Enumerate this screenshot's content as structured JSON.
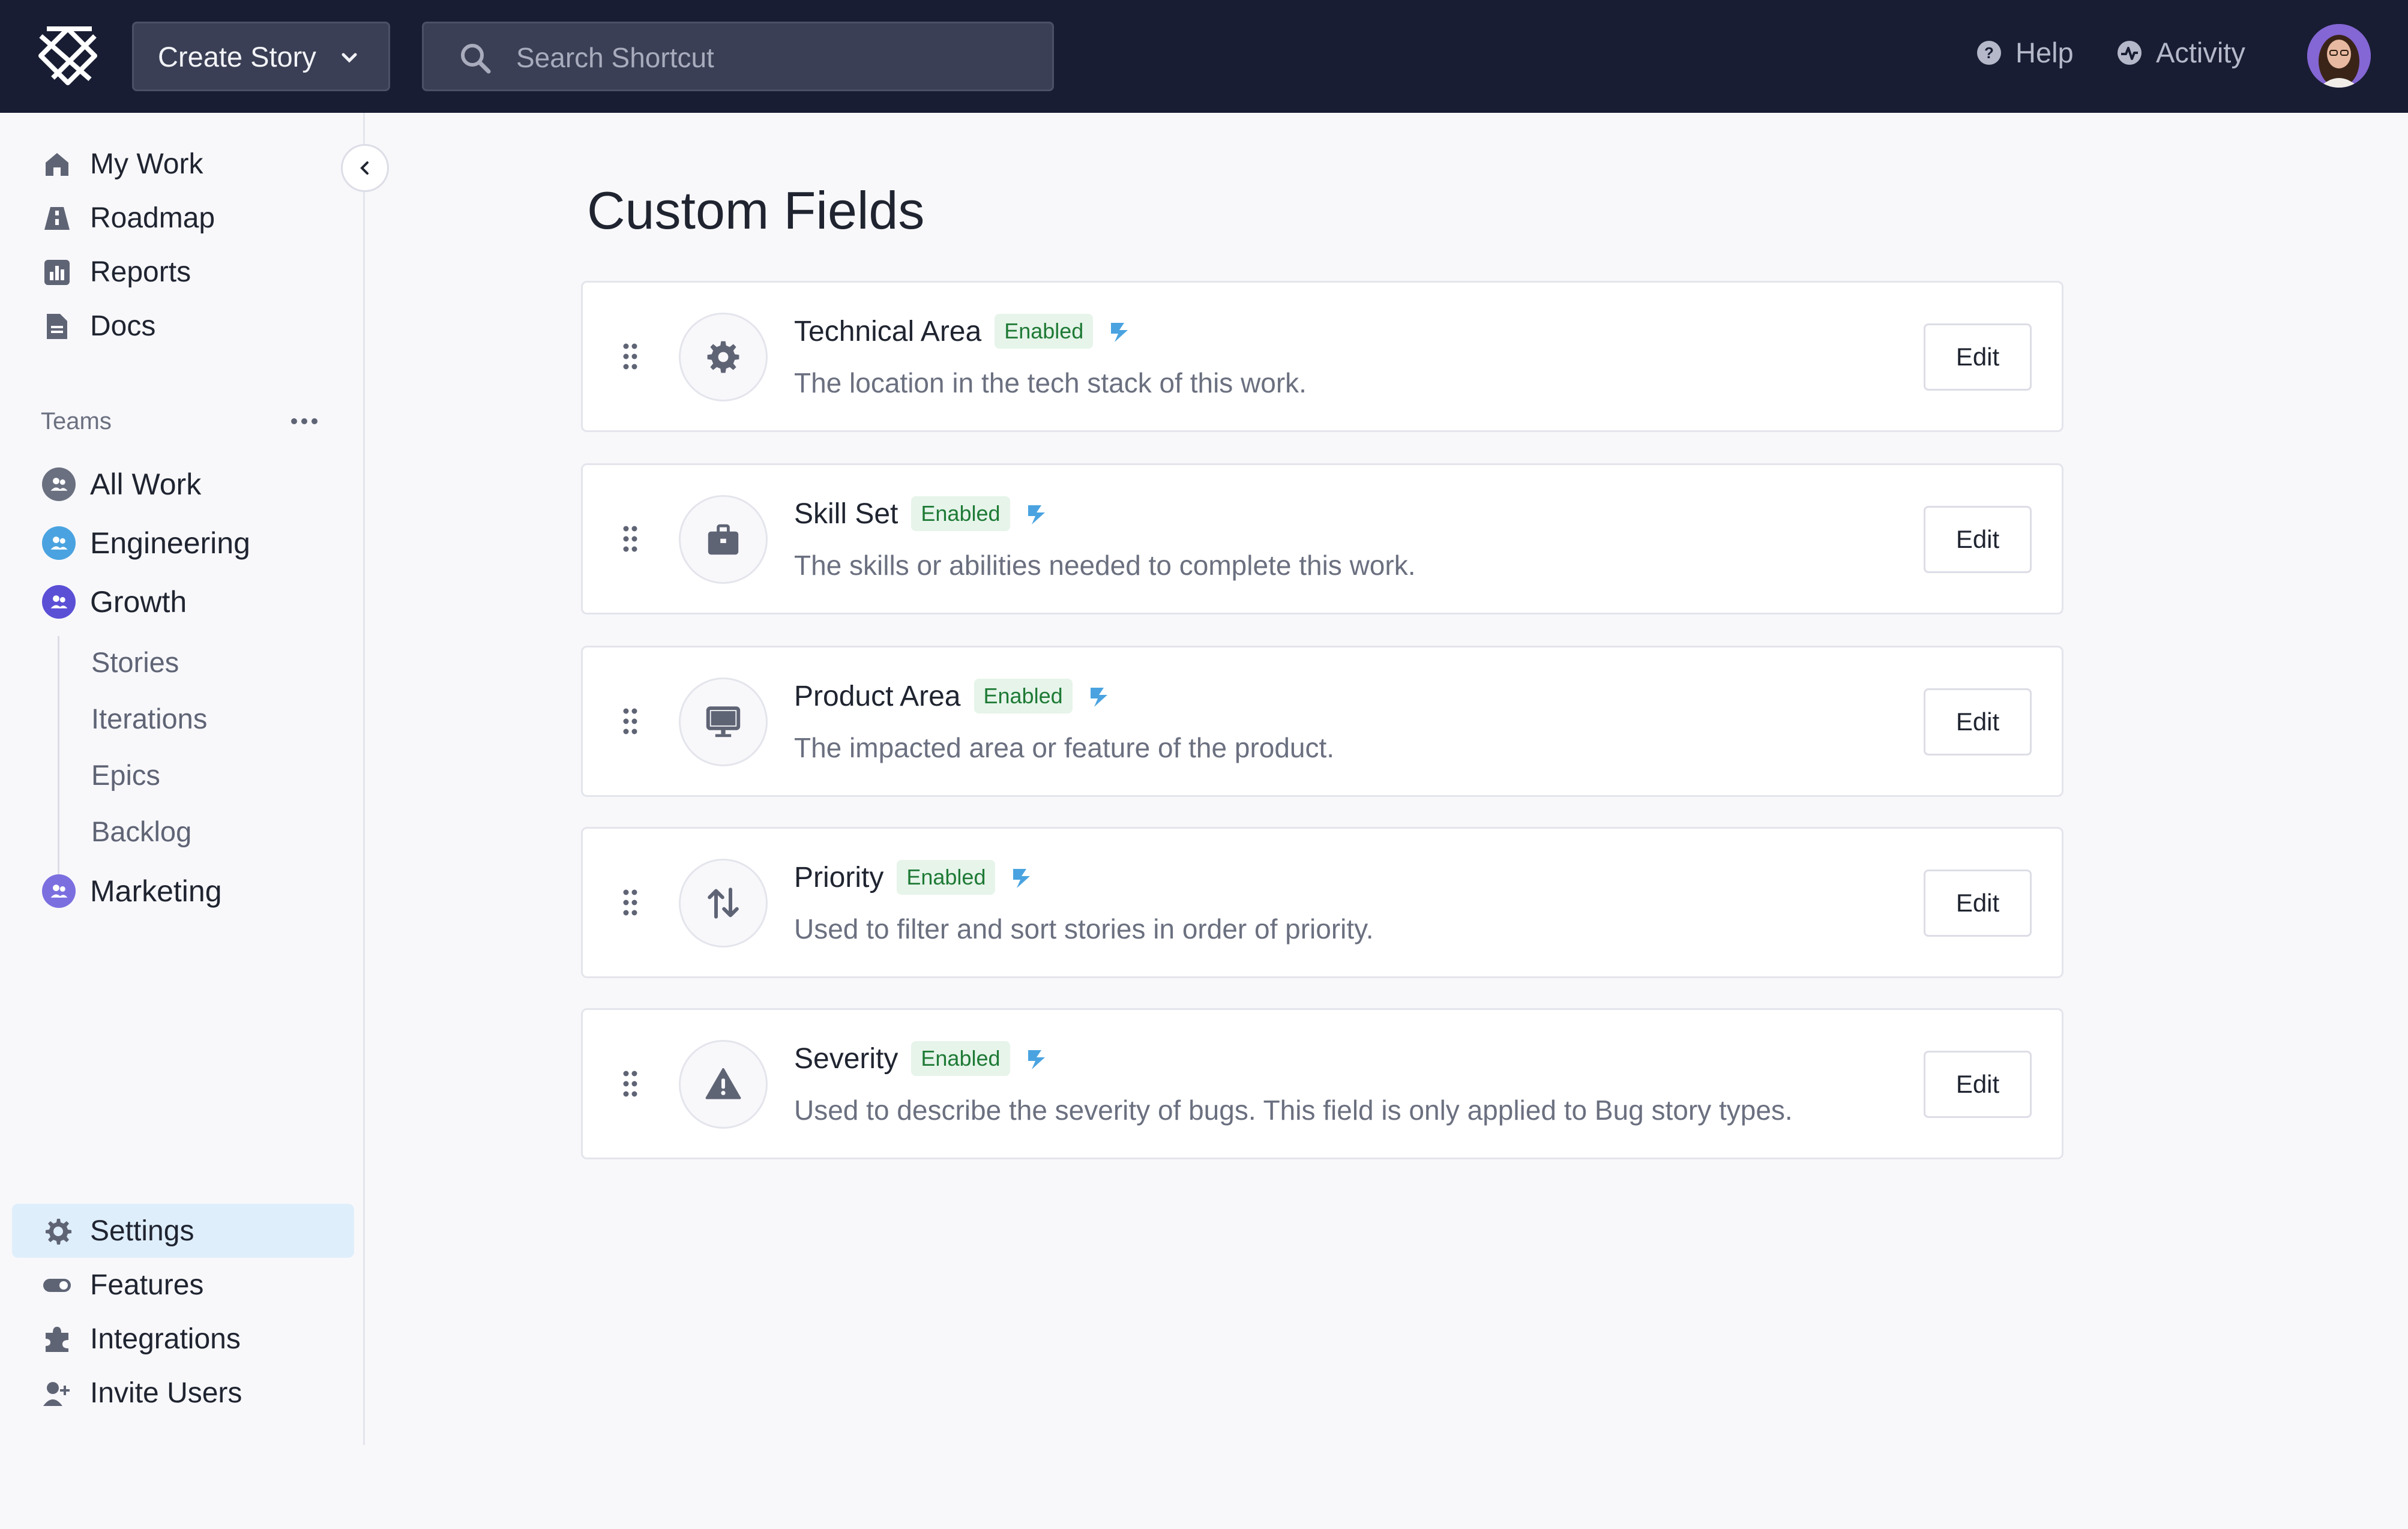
{
  "topbar": {
    "create_label": "Create Story",
    "search_placeholder": "Search Shortcut",
    "help_label": "Help",
    "activity_label": "Activity"
  },
  "sidebar": {
    "nav": [
      {
        "label": "My Work",
        "icon": "home-icon"
      },
      {
        "label": "Roadmap",
        "icon": "roadmap-icon"
      },
      {
        "label": "Reports",
        "icon": "reports-icon"
      },
      {
        "label": "Docs",
        "icon": "docs-icon"
      }
    ],
    "teams_label": "Teams",
    "teams": [
      {
        "label": "All Work",
        "color": "#6b7080"
      },
      {
        "label": "Engineering",
        "color": "#4aa3e0"
      },
      {
        "label": "Growth",
        "color": "#5b4fd6"
      }
    ],
    "growth_sub": [
      "Stories",
      "Iterations",
      "Epics",
      "Backlog"
    ],
    "marketing": {
      "label": "Marketing",
      "color": "#7b6fe0"
    },
    "bottom": [
      {
        "label": "Settings",
        "icon": "gear-icon"
      },
      {
        "label": "Features",
        "icon": "toggle-icon"
      },
      {
        "label": "Integrations",
        "icon": "puzzle-icon"
      },
      {
        "label": "Invite Users",
        "icon": "add-user-icon"
      }
    ]
  },
  "main": {
    "title": "Custom Fields",
    "fields": [
      {
        "name": "Technical Area",
        "status": "Enabled",
        "description": "The location in the tech stack of this work.",
        "icon": "gear-icon",
        "edit_label": "Edit"
      },
      {
        "name": "Skill Set",
        "status": "Enabled",
        "description": "The skills or abilities needed to complete this work.",
        "icon": "briefcase-icon",
        "edit_label": "Edit"
      },
      {
        "name": "Product Area",
        "status": "Enabled",
        "description": "The impacted area or feature of the product.",
        "icon": "monitor-icon",
        "edit_label": "Edit"
      },
      {
        "name": "Priority",
        "status": "Enabled",
        "description": "Used to filter and sort stories in order of priority.",
        "icon": "sort-arrows-icon",
        "edit_label": "Edit"
      },
      {
        "name": "Severity",
        "status": "Enabled",
        "description": "Used to describe the severity of bugs. This field is only applied to Bug story types.",
        "icon": "warning-icon",
        "edit_label": "Edit"
      }
    ]
  },
  "colors": {
    "topbar": "#181d33",
    "accent": "#dfeefb",
    "badge_bg": "#e6f4ea",
    "badge_text": "#1e7a35"
  }
}
